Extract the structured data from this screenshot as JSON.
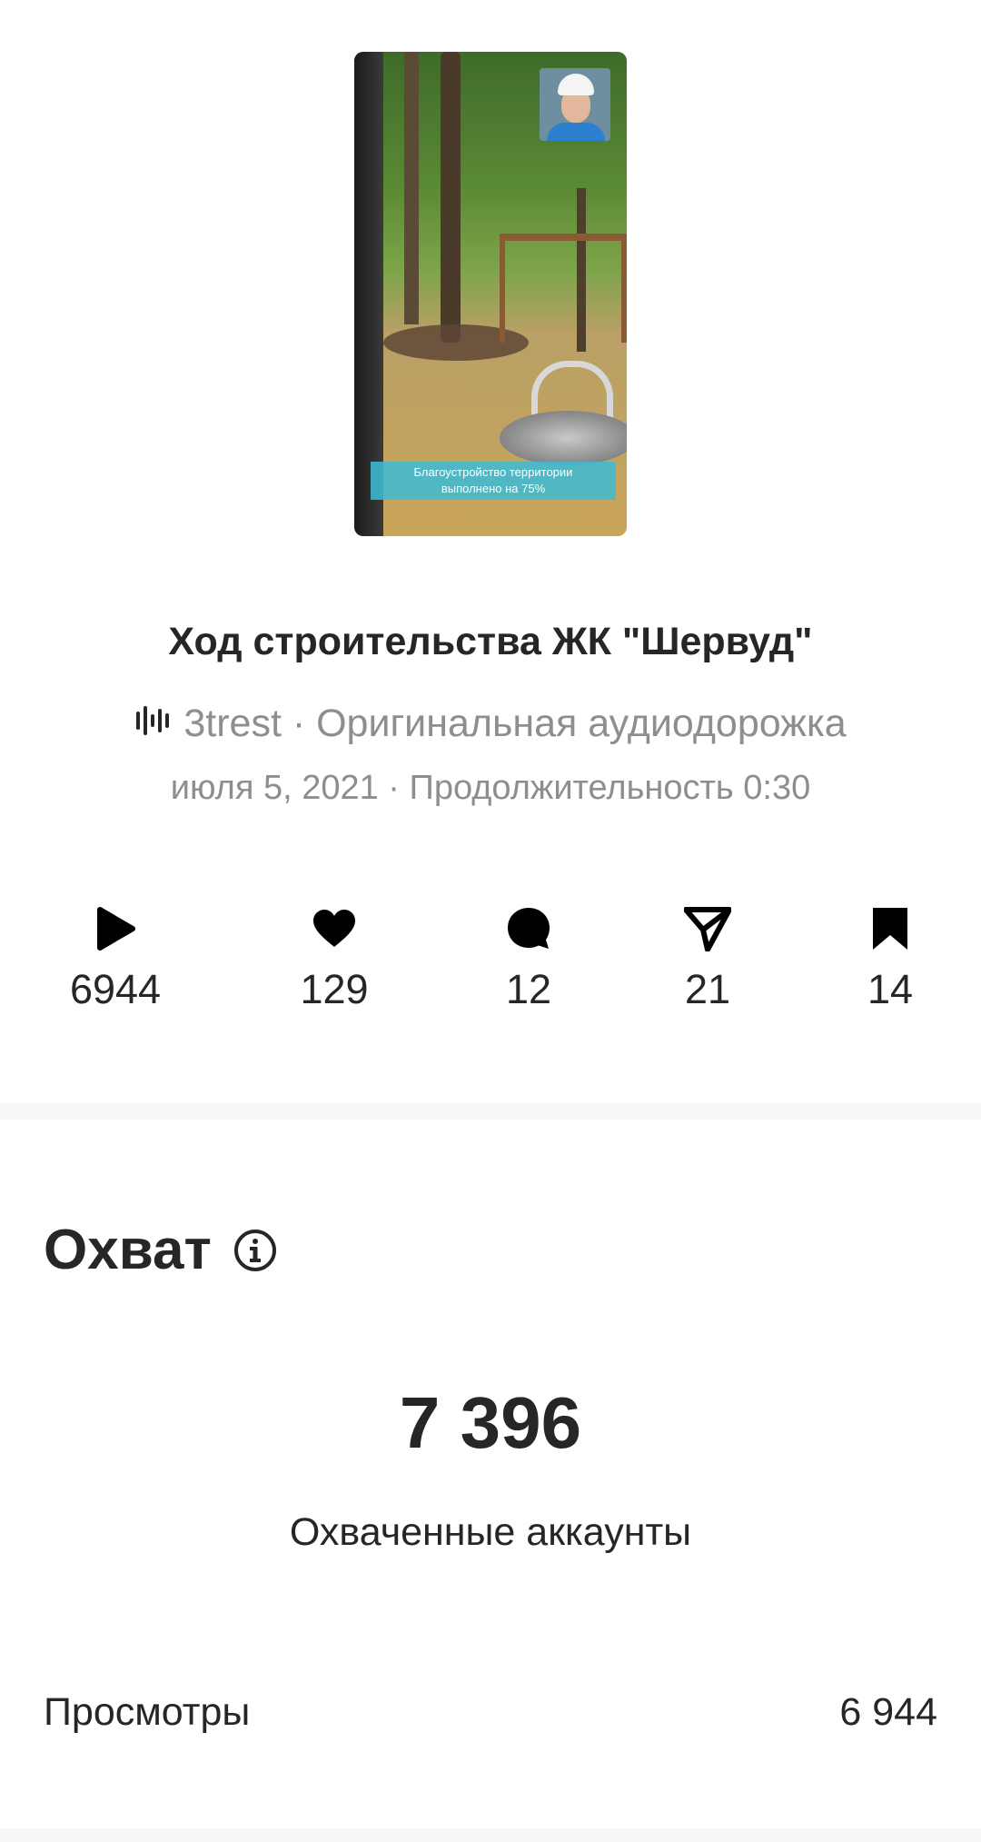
{
  "reel": {
    "caption_line1": "Благоустройство территории",
    "caption_line2": "выполнено на 75%",
    "title": "Ход строительства ЖК \"Шервуд\"",
    "audio": "3trest · Оригинальная аудиодорожка",
    "meta": "июля 5, 2021 · Продолжительность 0:30"
  },
  "stats": {
    "plays": "6944",
    "likes": "129",
    "comments": "12",
    "shares": "21",
    "saves": "14"
  },
  "reach": {
    "section_title": "Охват",
    "value": "7 396",
    "label": "Охваченные аккаунты"
  },
  "rows": [
    {
      "label": "Просмотры",
      "value": "6 944"
    }
  ],
  "icons": {
    "audio": "audio-wave-icon",
    "plays": "play-icon",
    "likes": "heart-icon",
    "comments": "comment-icon",
    "shares": "send-icon",
    "saves": "bookmark-icon",
    "info": "info-icon"
  }
}
